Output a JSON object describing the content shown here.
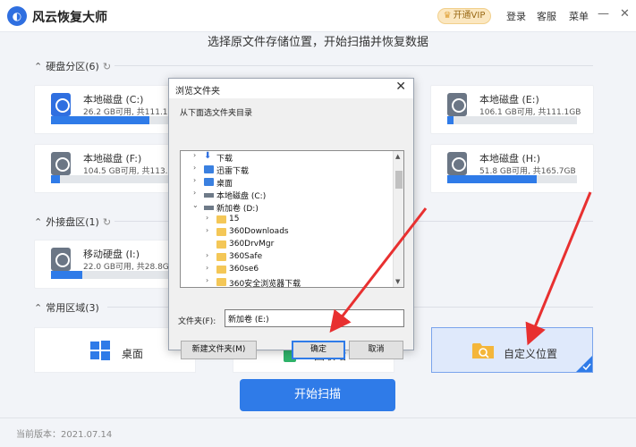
{
  "app": {
    "title": "风云恢复大师",
    "vip_label": "开通VIP",
    "login": "登录",
    "service": "客服",
    "menu": "菜单",
    "minimize": "—",
    "close": "✕"
  },
  "subtitle": "选择原文件存储位置，开始扫描并恢复数据",
  "sections": {
    "disks": "硬盘分区(6)",
    "external": "外接盘区(1)",
    "common": "常用区域(3)"
  },
  "disks": [
    {
      "name": "本地磁盘 (C:)",
      "info": "26.2 GB可用, 共111.1GB",
      "used": 0.76
    },
    {
      "name": "本地磁盘 (E:)",
      "info": "106.1 GB可用, 共111.1GB",
      "used": 0.05
    },
    {
      "name": "本地磁盘 (F:)",
      "info": "104.5 GB可用, 共113.3GB",
      "used": 0.08
    },
    {
      "name": "本地磁盘 (H:)",
      "info": "51.8 GB可用, 共165.7GB",
      "used": 0.69
    },
    {
      "name": "移动硬盘 (I:)",
      "info": "22.0 GB可用, 共28.8GB",
      "used": 0.24
    }
  ],
  "locations": {
    "desktop": "桌面",
    "recycle": "回收站",
    "custom": "自定义位置"
  },
  "start_button": "开始扫描",
  "version": "当前版本：2021.07.14",
  "dialog": {
    "title": "浏览文件夹",
    "prompt": "从下面选文件夹目录",
    "tree": [
      {
        "label": "下载",
        "icon": "download-icon",
        "level": 1,
        "expandable": true
      },
      {
        "label": "迅雷下载",
        "icon": "thunder-icon",
        "level": 1,
        "expandable": true
      },
      {
        "label": "桌面",
        "icon": "desktop-icon",
        "level": 1,
        "expandable": true
      },
      {
        "label": "本地磁盘 (C:)",
        "icon": "drive-icon",
        "level": 1,
        "expandable": true
      },
      {
        "label": "新加卷 (D:)",
        "icon": "drive-icon",
        "level": 1,
        "expanded": true
      },
      {
        "label": "15",
        "icon": "folder-icon",
        "level": 2,
        "expandable": true
      },
      {
        "label": "360Downloads",
        "icon": "folder-icon",
        "level": 2,
        "expandable": true
      },
      {
        "label": "360DrvMgr",
        "icon": "folder-icon",
        "level": 2,
        "expandable": false
      },
      {
        "label": "360Safe",
        "icon": "folder-icon",
        "level": 2,
        "expandable": true
      },
      {
        "label": "360se6",
        "icon": "folder-icon",
        "level": 2,
        "expandable": true
      },
      {
        "label": "360安全浏览器下载",
        "icon": "folder-icon",
        "level": 2,
        "expandable": true
      }
    ],
    "folder_label": "文件夹(F):",
    "folder_value": "新加卷 (E:)",
    "new_folder": "新建文件夹(M)",
    "ok": "确定",
    "cancel": "取消"
  },
  "colors": {
    "accent": "#2f7be8",
    "arrow": "#e83030"
  }
}
